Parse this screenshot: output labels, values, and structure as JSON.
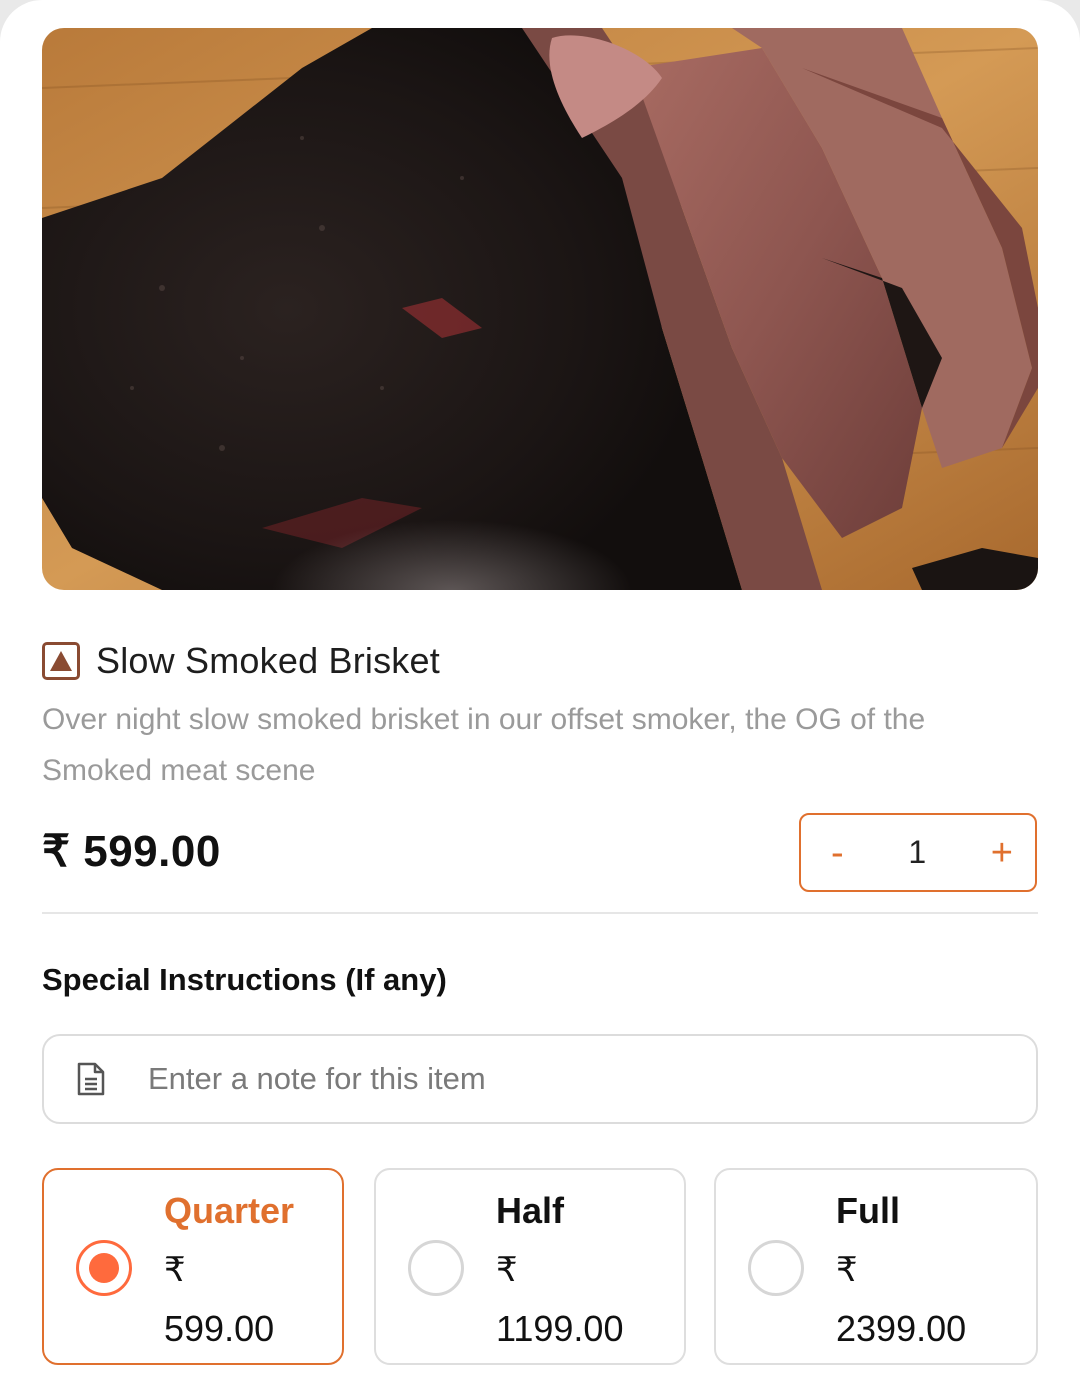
{
  "item": {
    "image_alt": "Slow smoked brisket on a wooden board",
    "title": "Slow Smoked Brisket",
    "description": "Over night slow smoked brisket in our offset smoker, the OG of the Smoked meat scene",
    "price": "₹ 599.00"
  },
  "quantity": {
    "minus": "-",
    "value": "1",
    "plus": "+"
  },
  "instructions": {
    "title": "Special Instructions (If any)",
    "placeholder": "Enter a note for this item",
    "value": ""
  },
  "options": [
    {
      "label": "Quarter",
      "currency": "₹",
      "price": "599.00",
      "selected": true
    },
    {
      "label": "Half",
      "currency": "₹",
      "price": "1199.00",
      "selected": false
    },
    {
      "label": "Full",
      "currency": "₹",
      "price": "2399.00",
      "selected": false
    }
  ],
  "colors": {
    "accent": "#e0702e",
    "radio_selected": "#ff6a3d",
    "veg_mark": "#8a4b32"
  },
  "icons": {
    "food_type": "non-veg-triangle-icon",
    "note": "document-note-icon"
  }
}
